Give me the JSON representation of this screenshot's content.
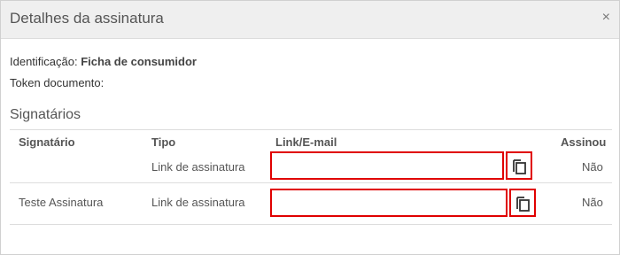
{
  "dialog": {
    "title": "Detalhes da assinatura",
    "close_label": "×"
  },
  "info": {
    "identificacao_label": "Identificação:",
    "identificacao_value": "Ficha de consumidor",
    "token_label": "Token documento:"
  },
  "signatarios": {
    "section_title": "Signatários",
    "columns": [
      "Signatário",
      "Tipo",
      "Link/E-mail",
      "Assinou"
    ],
    "rows": [
      {
        "signatario": "",
        "tipo": "Link de assinatura",
        "link": "",
        "assinou": "Não"
      },
      {
        "signatario": "Teste Assinatura",
        "tipo": "Link de assinatura",
        "link": "",
        "assinou": "Não"
      }
    ]
  },
  "colors": {
    "highlight": "#e00000",
    "header_bg": "#efefef"
  },
  "icons": {
    "close": "close-icon",
    "copy": "copy-icon"
  }
}
